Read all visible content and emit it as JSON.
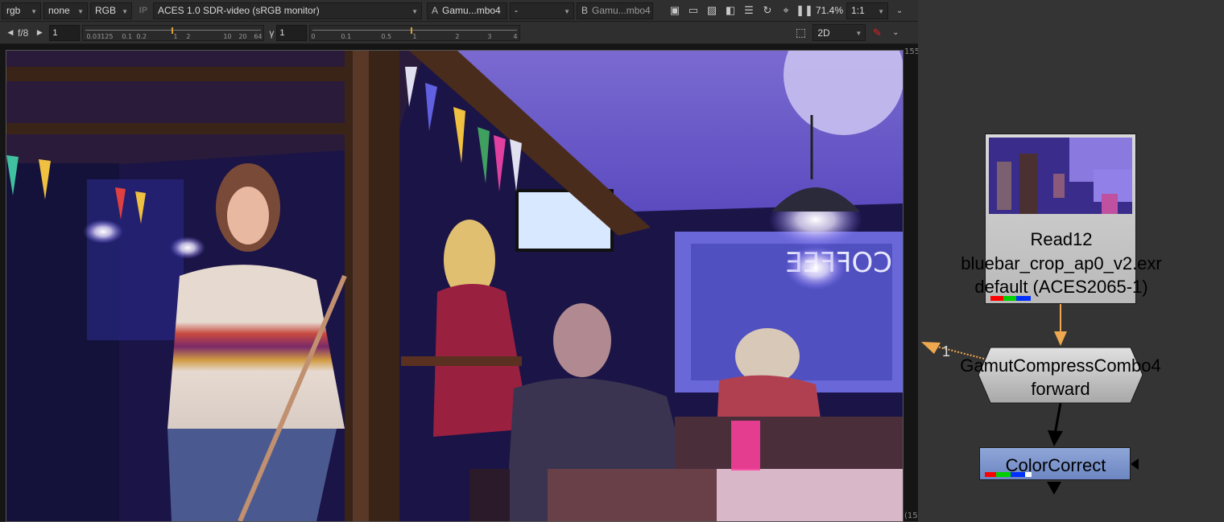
{
  "viewer": {
    "toolbar1": {
      "channels": "rgb",
      "mask": "none",
      "display_channels": "RGB",
      "ip_label": "IP",
      "display_transform": "ACES 1.0 SDR-video (sRGB monitor)",
      "input_a_label": "A",
      "input_a": "Gamu...mbo4",
      "composite": "-",
      "input_b_label": "B",
      "input_b": "Gamu...mbo4",
      "zoom": "71.4%",
      "proxy": "1:1"
    },
    "toolbar2": {
      "fstop": "f/8",
      "gain_value": "1",
      "gain_ticks": [
        "0.03125",
        "0.1",
        "0.2",
        "1",
        "2",
        "10",
        "20",
        "64"
      ],
      "gamma_symbol": "γ",
      "gamma_value": "1",
      "gamma_ticks": [
        "0",
        "0.1",
        "0.5",
        "1",
        "2",
        "3",
        "4"
      ],
      "view_mode": "2D"
    },
    "edge_top_right": "155",
    "edge_bottom_right": "(15"
  },
  "nodegraph": {
    "read_node": {
      "name": "Read12",
      "file": "bluebar_crop_ap0_v2.exr",
      "colorspace": "default (ACES2065-1)"
    },
    "gamut_node": {
      "name": "GamutCompressCombo4",
      "direction": "forward",
      "input_label": "1"
    },
    "cc_node": {
      "name": "ColorCorrect"
    },
    "colors": {
      "pipe_orange": "#f0a850",
      "pipe_black": "#000000",
      "channel_red": "#ff0000",
      "channel_green": "#00d000",
      "channel_blue": "#0030ff"
    }
  }
}
